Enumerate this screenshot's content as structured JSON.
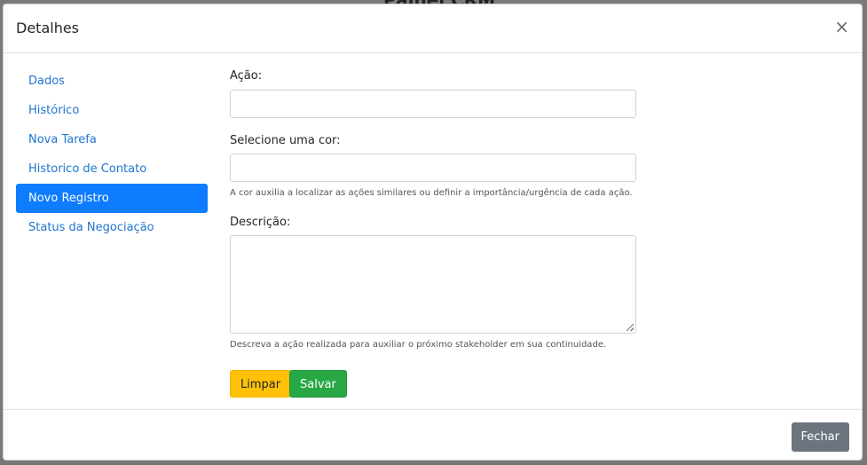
{
  "background": {
    "title": "Painel CRM"
  },
  "modal": {
    "title": "Detalhes",
    "close_symbol": "×"
  },
  "sidebar": {
    "items": [
      {
        "label": "Dados"
      },
      {
        "label": "Histórico"
      },
      {
        "label": "Nova Tarefa"
      },
      {
        "label": "Historico de Contato"
      },
      {
        "label": "Novo Registro"
      },
      {
        "label": "Status da Negociação"
      }
    ],
    "active_index": 4
  },
  "form": {
    "acao_label": "Ação:",
    "acao_value": "",
    "cor_label": "Selecione uma cor:",
    "cor_value": "",
    "cor_help": "A cor auxilia a localizar as ações similares ou definir a importância/urgência de cada ação.",
    "descricao_label": "Descrição:",
    "descricao_value": "",
    "descricao_help": "Descreva a ação realizada para auxiliar o próximo stakeholder em sua continuidade.",
    "clear_label": "Limpar",
    "save_label": "Salvar"
  },
  "footer": {
    "close_label": "Fechar"
  },
  "colors": {
    "active_nav": "#0d7cff",
    "link": "#1f75cf",
    "clear_button": "#ffc107",
    "save_button": "#28a745",
    "close_button": "#6c757d"
  }
}
